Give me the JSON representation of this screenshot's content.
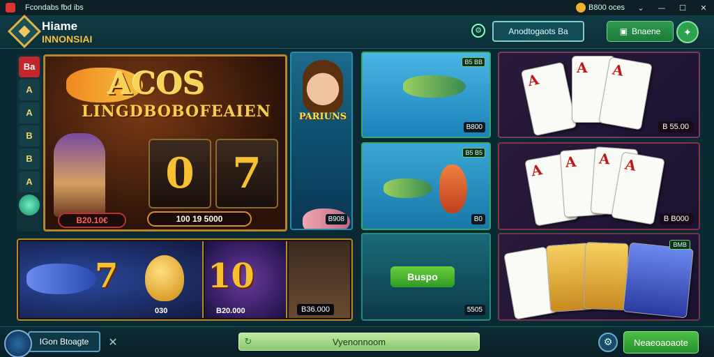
{
  "window": {
    "title": "Fcondabs fbd ibs",
    "balance": "B800 oces",
    "controls": [
      "chevron-down-icon",
      "minimize-icon",
      "maximize-icon",
      "close-icon"
    ]
  },
  "header": {
    "logo_title": "Hiame",
    "logo_subtitle": "INNONSIAI",
    "account_button": "Anodtogaots Ba",
    "green_button": "Bnaene"
  },
  "sidebar": {
    "items": [
      "Ba",
      "A",
      "A",
      "B",
      "B",
      "A"
    ]
  },
  "hero": {
    "title": "ACOS",
    "subtitle": "LINGDBOBOFEAIEN",
    "reel1": "0",
    "reel2": "7",
    "left_pill": "B20.10€",
    "center_pill": "100 19 5000"
  },
  "persona": {
    "label": "PARIUNS",
    "value": "B908"
  },
  "fish_tiles": [
    {
      "tag": "B5 BB",
      "value": "B800"
    },
    {
      "tag": "B5 B5",
      "value": "B0"
    },
    {
      "play": "Buspo",
      "value": "5505"
    }
  ],
  "card_tiles": [
    {
      "value": "B 55.00"
    },
    {
      "value": "B B000"
    },
    {
      "tag": "BMB"
    }
  ],
  "bottom_row": {
    "number_a": "7",
    "egg_value": "030",
    "number_b": "10",
    "prize": "B20.000",
    "last_value": "B36.000"
  },
  "footer": {
    "user_label": "IGon Btoagte",
    "progress_text": "Vyenonnoom",
    "action_button": "Neaeoaoaote"
  }
}
